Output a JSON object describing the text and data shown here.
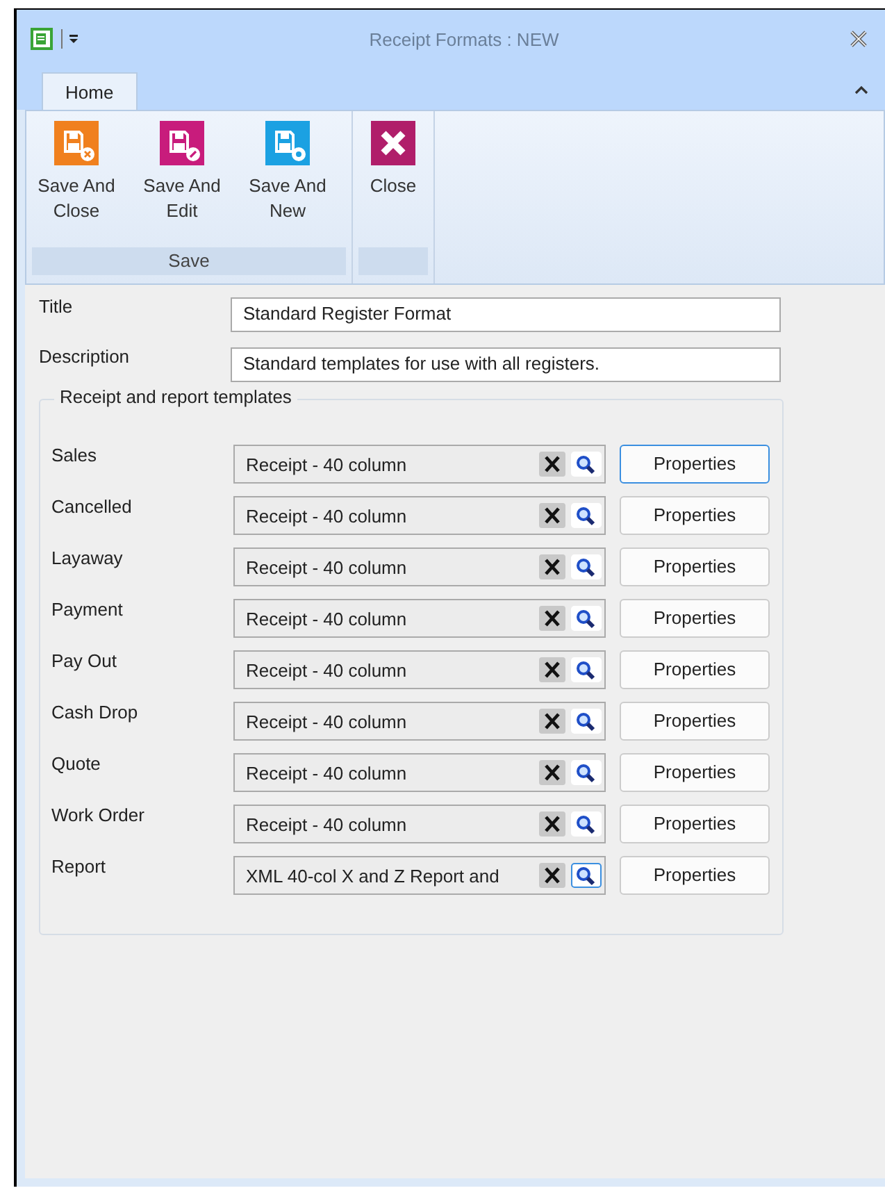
{
  "window": {
    "title": "Receipt Formats : NEW"
  },
  "tabs": [
    {
      "label": "Home",
      "selected": true
    }
  ],
  "ribbon_groups": [
    {
      "label": "Save",
      "buttons": [
        {
          "label": "Save And Close",
          "kind": "close",
          "color": "#f0801e"
        },
        {
          "label": "Save And Edit",
          "kind": "edit",
          "color": "#c81c7c"
        },
        {
          "label": "Save And New",
          "kind": "new",
          "color": "#1ba1e2"
        }
      ]
    },
    {
      "buttons": [
        {
          "label": "Close",
          "kind": "cross",
          "color": "#b01e6a"
        }
      ]
    }
  ],
  "fields": [
    {
      "label": "Title",
      "value": "Standard Register Format"
    },
    {
      "label": "Description",
      "value": "Standard templates for use with all registers."
    }
  ],
  "templates": {
    "title": "Receipt and report templates",
    "rows": [
      {
        "label": "Sales",
        "value": "Receipt - 40 column",
        "search_focused": false,
        "button": "Properties",
        "button_focused": true
      },
      {
        "label": "Cancelled",
        "value": "Receipt - 40 column",
        "search_focused": false,
        "button": "Properties",
        "button_focused": false
      },
      {
        "label": "Layaway",
        "value": "Receipt - 40 column",
        "search_focused": false,
        "button": "Properties",
        "button_focused": false
      },
      {
        "label": "Payment",
        "value": "Receipt - 40 column",
        "search_focused": false,
        "button": "Properties",
        "button_focused": false
      },
      {
        "label": "Pay Out",
        "value": "Receipt - 40 column",
        "search_focused": false,
        "button": "Properties",
        "button_focused": false
      },
      {
        "label": "Cash Drop",
        "value": "Receipt - 40 column",
        "search_focused": false,
        "button": "Properties",
        "button_focused": false
      },
      {
        "label": "Quote",
        "value": "Receipt - 40 column",
        "search_focused": false,
        "button": "Properties",
        "button_focused": false
      },
      {
        "label": "Work Order",
        "value": "Receipt - 40 column",
        "search_focused": false,
        "button": "Properties",
        "button_focused": false
      },
      {
        "label": "Report",
        "value": "XML 40-col X and Z Report and",
        "search_focused": true,
        "button": "Properties",
        "button_focused": false
      }
    ]
  }
}
